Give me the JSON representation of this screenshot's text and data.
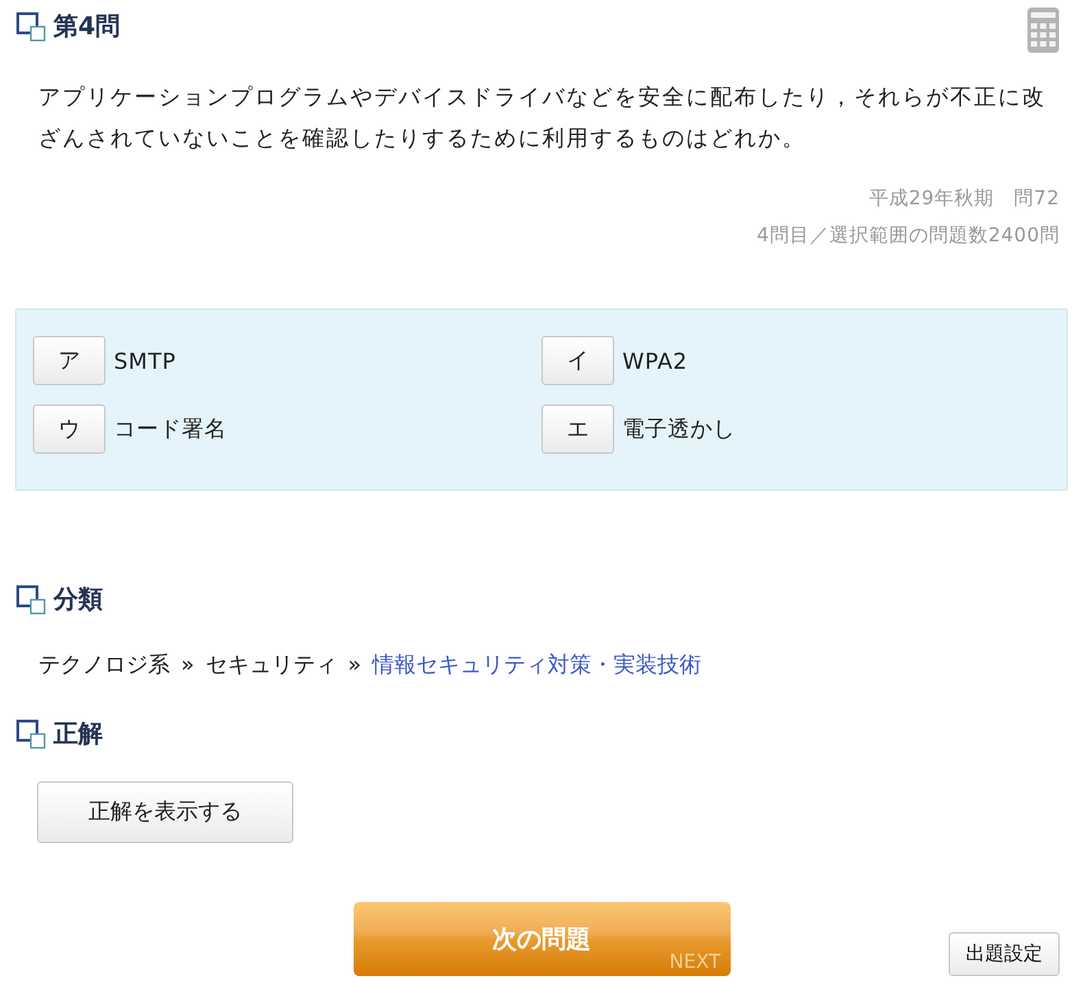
{
  "question": {
    "title": "第4問",
    "text": "アプリケーションプログラムやデバイスドライバなどを安全に配布したり，それらが不正に改ざんされていないことを確認したりするために利用するものはどれか。",
    "exam": "平成29年秋期　問72",
    "progress": "4問目／選択範囲の問題数2400問"
  },
  "choices": [
    {
      "key": "ア",
      "text": "SMTP"
    },
    {
      "key": "イ",
      "text": "WPA2"
    },
    {
      "key": "ウ",
      "text": "コード署名"
    },
    {
      "key": "エ",
      "text": "電子透かし"
    }
  ],
  "category": {
    "title": "分類",
    "path": [
      {
        "kind": "text",
        "text": "テクノロジ系"
      },
      {
        "kind": "separator",
        "text": "»"
      },
      {
        "kind": "text",
        "text": "セキュリティ"
      },
      {
        "kind": "separator",
        "text": "»"
      },
      {
        "kind": "link",
        "text": "情報セキュリティ対策・実装技術"
      }
    ]
  },
  "answer": {
    "title": "正解",
    "button": "正解を表示する"
  },
  "footer": {
    "next_button": {
      "label": "次の問題",
      "sublabel": "NEXT"
    },
    "settings_button": "出題設定"
  }
}
